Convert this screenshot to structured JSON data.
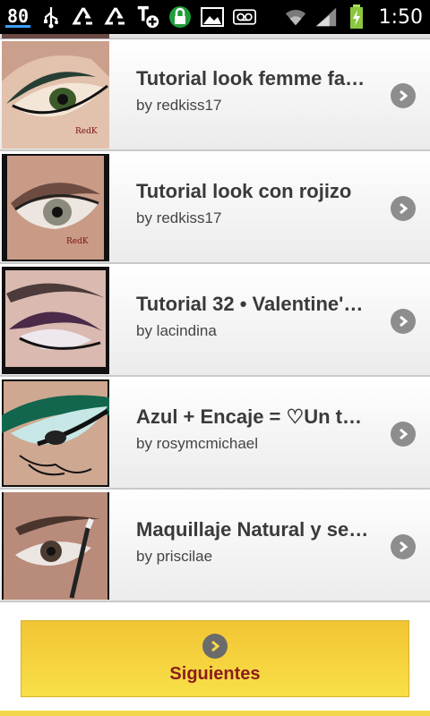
{
  "status_bar": {
    "notification_count": "80",
    "time": "1:50",
    "icons": [
      "usb-icon",
      "recycle-icon",
      "recycle-icon",
      "t-plus-icon",
      "lock-icon",
      "image-icon",
      "voicemail-icon",
      "wifi-icon",
      "signal-icon",
      "battery-charging-icon"
    ]
  },
  "list": {
    "items": [
      {
        "title": "Tutorial look femme fa…",
        "author": "by redkiss17"
      },
      {
        "title": "Tutorial look con rojizo",
        "author": "by redkiss17"
      },
      {
        "title": "Tutorial 32 • Valentine'…",
        "author": "by lacindina"
      },
      {
        "title": "Azul + Encaje = ♡Un t…",
        "author": "by rosymcmichael"
      },
      {
        "title": "Maquillaje Natural y se…",
        "author": "by priscilae"
      }
    ]
  },
  "footer": {
    "next_label": "Siguientes"
  },
  "colors": {
    "button_top": "#f2c433",
    "button_bottom": "#f8e048",
    "button_text": "#8b1d1d",
    "chevron": "#8d8d8d"
  }
}
